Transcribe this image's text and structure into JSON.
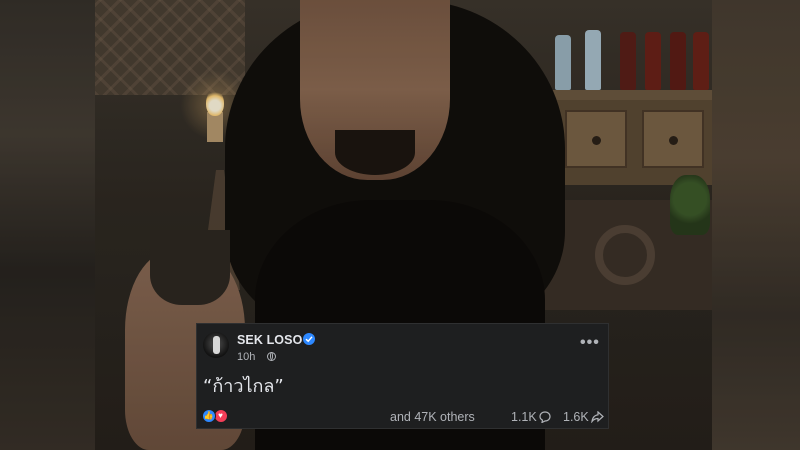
{
  "post": {
    "page_name": "SEK LOSO",
    "time": "10h",
    "privacy_icon": "globe-icon",
    "verified_icon": "verified-badge-icon",
    "more_label": "•••",
    "text": "“ก้าวไกล”",
    "reactions": [
      "like-icon",
      "love-icon"
    ],
    "reactions_text": "and 47K others",
    "comments_count": "1.1K",
    "shares_count": "1.6K"
  },
  "colors": {
    "card_bg": "#1e1f20",
    "primary_text": "#e4e6eb",
    "secondary_text": "#b0b3b8",
    "verified_blue": "#2d88ff",
    "love_red": "#f33e58"
  }
}
